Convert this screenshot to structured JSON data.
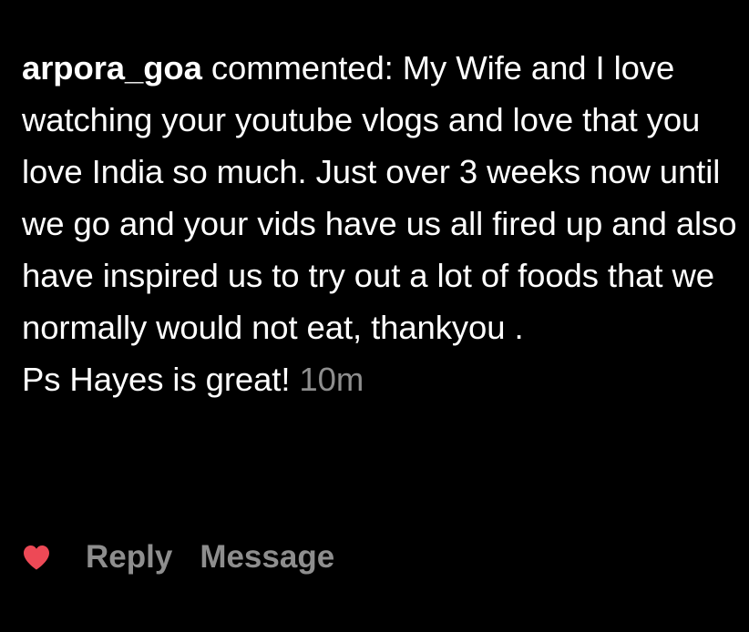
{
  "comment": {
    "username": "arpora_goa",
    "verb": "commented:",
    "body": "My Wife and I love watching your youtube vlogs and love that you love India so much. Just over 3 weeks now until we go and your vids have us all fired up and also have inspired us to try out a lot of foods that we normally would not eat, thankyou .",
    "ps": "Ps Hayes is great!",
    "timestamp": "10m"
  },
  "actions": {
    "like_icon": "heart-icon",
    "like_color": "#ed4956",
    "reply_label": "Reply",
    "message_label": "Message"
  },
  "colors": {
    "background": "#000000",
    "text": "#ffffff",
    "muted": "#8e8e8e"
  }
}
